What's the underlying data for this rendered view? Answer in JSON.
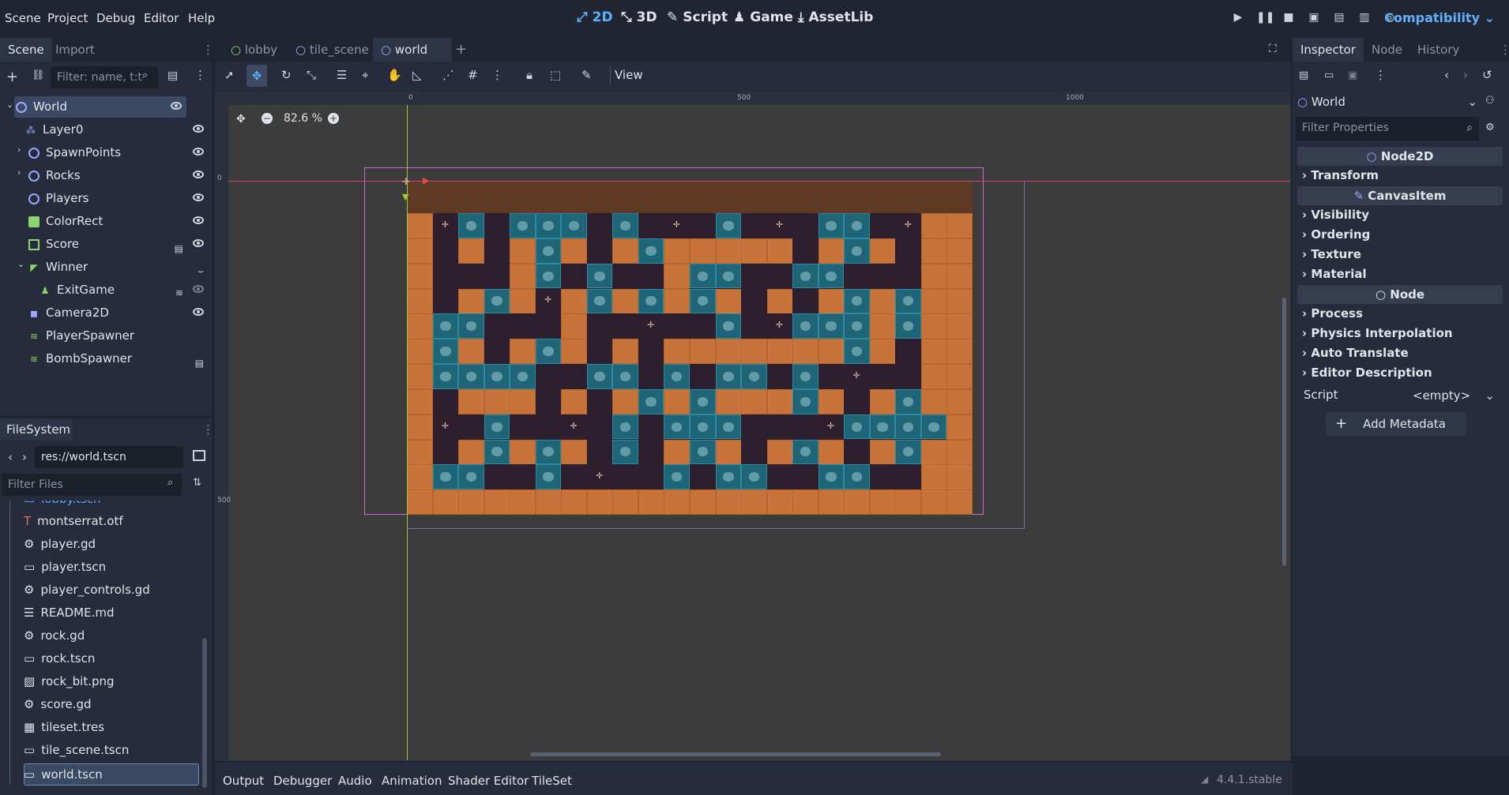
{
  "menu": [
    "Scene",
    "Project",
    "Debug",
    "Editor",
    "Help"
  ],
  "workspaces": [
    {
      "label": "2D",
      "icon": "2d-icon",
      "active": true
    },
    {
      "label": "3D",
      "icon": "3d-icon",
      "active": false
    },
    {
      "label": "Script",
      "icon": "script-icon",
      "active": false
    },
    {
      "label": "Game",
      "icon": "game-icon",
      "active": false
    },
    {
      "label": "AssetLib",
      "icon": "assetlib-icon",
      "active": false
    }
  ],
  "renderer": "Compatibility",
  "scene_dock": {
    "tabs": [
      "Scene",
      "Import"
    ],
    "filter_placeholder": "Filter: name, t:t",
    "tree": [
      {
        "label": "World",
        "icon": "node2d-icon",
        "selected": true
      },
      {
        "label": "Layer0",
        "icon": "tilemap-layer-icon"
      },
      {
        "label": "SpawnPoints",
        "icon": "node2d-icon"
      },
      {
        "label": "Rocks",
        "icon": "node2d-icon"
      },
      {
        "label": "Players",
        "icon": "node2d-icon"
      },
      {
        "label": "ColorRect",
        "icon": "colorrect-icon"
      },
      {
        "label": "Score",
        "icon": "hbox-icon"
      },
      {
        "label": "Winner",
        "icon": "label-icon"
      },
      {
        "label": "ExitGame",
        "icon": "button-icon"
      },
      {
        "label": "Camera2D",
        "icon": "camera-icon"
      },
      {
        "label": "PlayerSpawner",
        "icon": "spawner-icon"
      },
      {
        "label": "BombSpawner",
        "icon": "spawner-icon"
      }
    ]
  },
  "filesystem": {
    "title": "FileSystem",
    "path": "res://world.tscn",
    "filter_placeholder": "Filter Files",
    "files": [
      {
        "name": "lobby.tscn",
        "icon": "scene-icon"
      },
      {
        "name": "montserrat.otf",
        "icon": "font-icon"
      },
      {
        "name": "player.gd",
        "icon": "gear-icon"
      },
      {
        "name": "player.tscn",
        "icon": "scene-icon"
      },
      {
        "name": "player_controls.gd",
        "icon": "gear-icon"
      },
      {
        "name": "README.md",
        "icon": "doc-icon"
      },
      {
        "name": "rock.gd",
        "icon": "gear-icon"
      },
      {
        "name": "rock.tscn",
        "icon": "scene-icon"
      },
      {
        "name": "rock_bit.png",
        "icon": "image-icon"
      },
      {
        "name": "score.gd",
        "icon": "gear-icon"
      },
      {
        "name": "tileset.tres",
        "icon": "tileset-icon"
      },
      {
        "name": "tile_scene.tscn",
        "icon": "scene-icon"
      },
      {
        "name": "world.tscn",
        "icon": "scene-icon"
      }
    ]
  },
  "editor_tabs": [
    "lobby",
    "tile_scene",
    "world"
  ],
  "viewport": {
    "zoom": "82.6 %",
    "view_menu": "View",
    "ruler_labels": [
      "0",
      "500",
      "1000"
    ],
    "ruler_v_labels": [
      "0",
      "500"
    ]
  },
  "inspector": {
    "tabs": [
      "Inspector",
      "Node",
      "History"
    ],
    "object": "World",
    "filter_placeholder": "Filter Properties",
    "headers": [
      "Node2D",
      "CanvasItem",
      "Node"
    ],
    "node2d_sections": [
      "Transform"
    ],
    "canvasitem_sections": [
      "Visibility",
      "Ordering",
      "Texture",
      "Material"
    ],
    "node_sections": [
      "Process",
      "Physics Interpolation",
      "Auto Translate",
      "Editor Description"
    ],
    "script_label": "Script",
    "script_value": "<empty>",
    "add_metadata": "Add Metadata"
  },
  "bottom_panel": [
    "Output",
    "Debugger",
    "Audio",
    "Animation",
    "Shader Editor",
    "TileSet"
  ],
  "version": "4.4.1.stable",
  "colors": {
    "accent": "#57b3ff",
    "brick": "#c8733a",
    "floor": "#2e1f2e",
    "rock": "#1e6577",
    "top_wall": "#5e3a24"
  }
}
